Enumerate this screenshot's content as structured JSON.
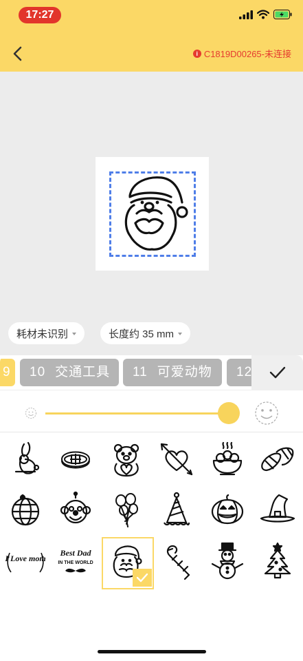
{
  "status_bar": {
    "time": "17:27"
  },
  "header": {
    "device_label": "C1819D00265-未连接",
    "info_icon": "info-icon"
  },
  "chips": {
    "material": "耗材未识别",
    "length": "长度约 35 mm"
  },
  "categories": {
    "partial_left": "9",
    "items": [
      {
        "num": "10",
        "label": "交通工具"
      },
      {
        "num": "11",
        "label": "可爱动物"
      },
      {
        "num": "12",
        "label": ""
      }
    ]
  },
  "slider": {
    "value": 0.97
  },
  "icons": [
    "rabbit-icon",
    "mooncake-icon",
    "teddy-bear-icon",
    "heart-arrow-icon",
    "food-bowl-icon",
    "candy-corn-icon",
    "globe-icon",
    "clown-face-icon",
    "balloons-icon",
    "party-hat-icon",
    "pumpkin-icon",
    "witch-hat-icon",
    "i-love-mom-icon",
    "best-dad-icon",
    "santa-icon",
    "candy-cane-icon",
    "snowman-icon",
    "christmas-tree-icon"
  ],
  "grid_text": {
    "love_mom": "I Love mom",
    "best_dad_1": "Best Dad",
    "best_dad_2": "IN THE WORLD"
  },
  "selected_icon": "santa-icon",
  "colors": {
    "accent": "#fbd866",
    "warning": "#e53b2f",
    "selection": "#4f7ee8"
  }
}
